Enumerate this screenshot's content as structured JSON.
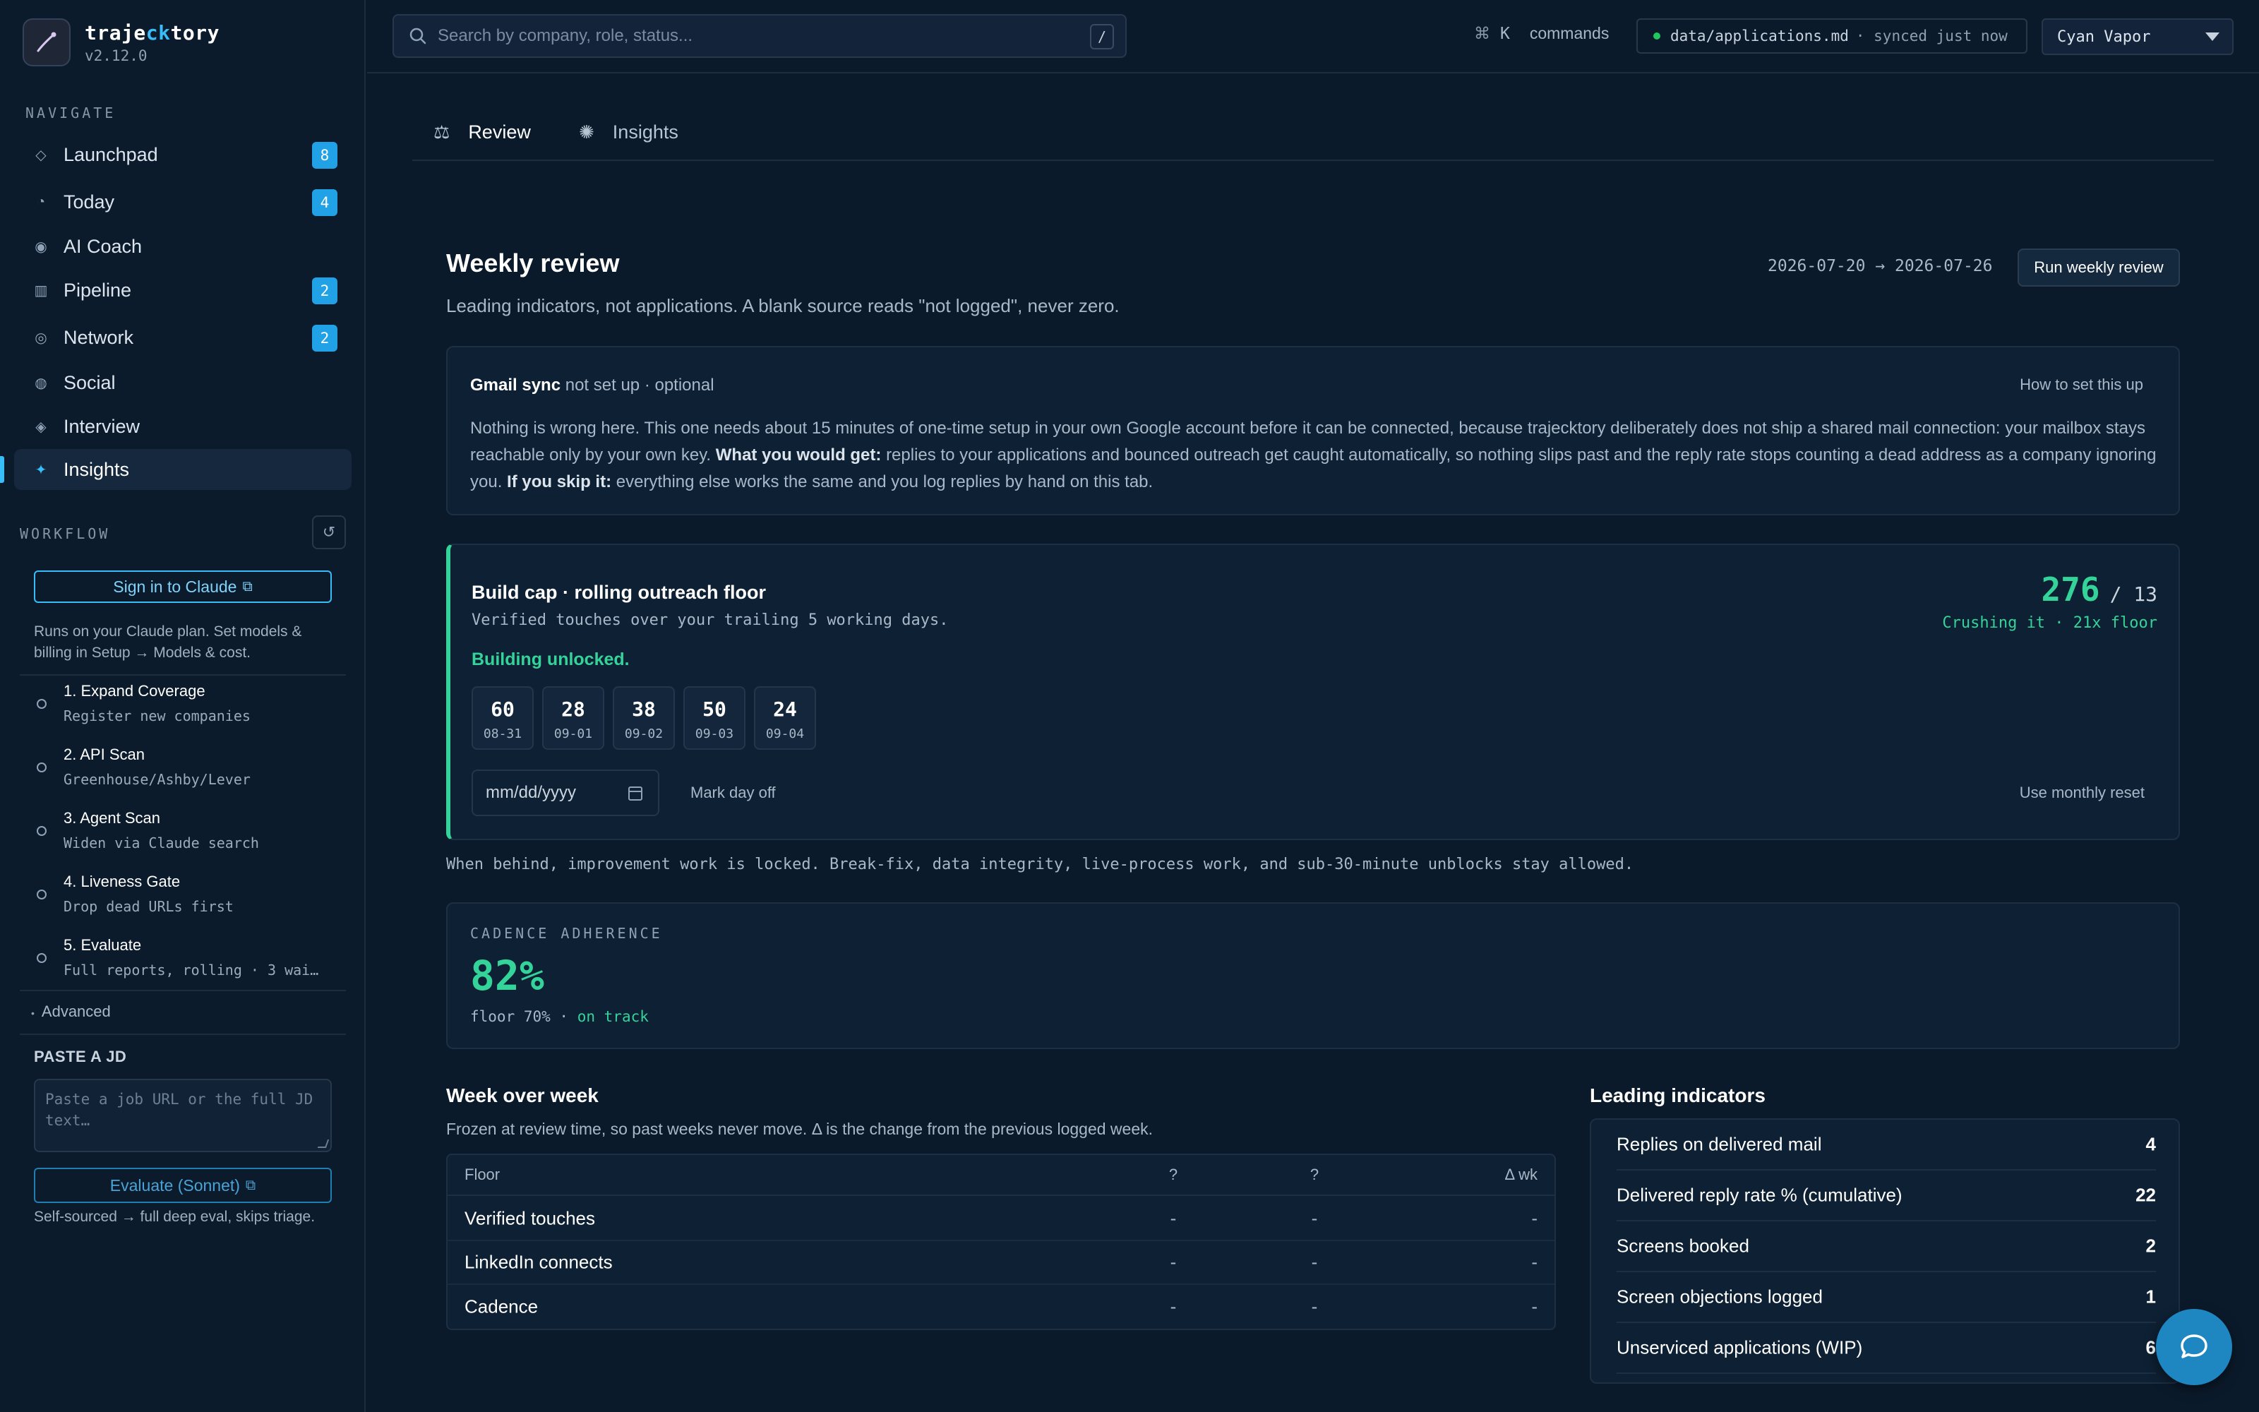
{
  "app": {
    "name_prefix": "traje",
    "name_accent": "ck",
    "name_suffix": "tory",
    "version": "v2.12.0"
  },
  "sidebar": {
    "navigate_label": "NAVIGATE",
    "nav": [
      {
        "label": "Launchpad",
        "badge": "8",
        "icon": "diamond-icon"
      },
      {
        "label": "Today",
        "badge": "4",
        "icon": "clock-icon"
      },
      {
        "label": "AI Coach",
        "badge": null,
        "icon": "target-icon"
      },
      {
        "label": "Pipeline",
        "badge": "2",
        "icon": "kanban-icon"
      },
      {
        "label": "Network",
        "badge": "2",
        "icon": "at-icon"
      },
      {
        "label": "Social",
        "badge": null,
        "icon": "globe-icon"
      },
      {
        "label": "Interview",
        "badge": null,
        "icon": "diamond-filled-icon"
      },
      {
        "label": "Insights",
        "badge": null,
        "icon": "sparkle-icon",
        "active": true
      }
    ],
    "workflow_label": "WORKFLOW",
    "signin_label": "Sign in to Claude",
    "signin_note": "Runs on your Claude plan. Set models & billing in Setup → Models & cost.",
    "steps": [
      {
        "title": "1. Expand Coverage",
        "sub": "Register new companies"
      },
      {
        "title": "2. API Scan",
        "sub": "Greenhouse/Ashby/Lever"
      },
      {
        "title": "3. Agent Scan",
        "sub": "Widen via Claude search"
      },
      {
        "title": "4. Liveness Gate",
        "sub": "Drop dead URLs first"
      },
      {
        "title": "5. Evaluate",
        "sub": "Full reports, rolling · 3 wai…"
      }
    ],
    "advanced_label": "Advanced",
    "paste_label": "PASTE A JD",
    "jd_placeholder": "Paste a job URL or the full JD text…",
    "evaluate_label": "Evaluate (Sonnet)",
    "selfsourced_note": "Self-sourced → full deep eval, skips triage."
  },
  "topbar": {
    "search_placeholder": "Search by company, role, status...",
    "search_shortcut": "/",
    "cmd_glyph": "⌘",
    "cmd_key": "K",
    "commands_label": "commands",
    "sync_file": "data/applications.md",
    "sync_status": "· synced just now",
    "theme": "Cyan Vapor"
  },
  "tabs": [
    {
      "label": "Review",
      "icon": "scale-icon"
    },
    {
      "label": "Insights",
      "icon": "loader-icon"
    }
  ],
  "review": {
    "title": "Weekly review",
    "subtitle": "Leading indicators, not applications. A blank source reads \"not logged\", never zero.",
    "date_range": "2026-07-20 → 2026-07-26",
    "run_label": "Run weekly review",
    "gmail": {
      "name": "Gmail sync",
      "status": "not set up · optional",
      "howto": "How to set this up",
      "body_1": "Nothing is wrong here. This one needs about 15 minutes of one-time setup in your own Google account before it can be connected, because trajecktory deliberately does not ship a shared mail connection: your mailbox stays reachable only by your own key.",
      "get_label": "What you would get:",
      "body_2": "replies to your applications and bounced outreach get caught automatically, so nothing slips past and the reply rate stops counting a dead address as a company ignoring you.",
      "skip_label": "If you skip it:",
      "body_3": "everything else works the same and you log replies by hand on this tab."
    },
    "build": {
      "title": "Build cap · rolling outreach floor",
      "sub": "Verified touches over your trailing 5 working days.",
      "status": "Building unlocked.",
      "count": "276",
      "floor": "/ 13",
      "count_note": "Crushing it · 21x floor",
      "days": [
        {
          "value": "60",
          "date": "08-31"
        },
        {
          "value": "28",
          "date": "09-01"
        },
        {
          "value": "38",
          "date": "09-02"
        },
        {
          "value": "50",
          "date": "09-03"
        },
        {
          "value": "24",
          "date": "09-04"
        }
      ],
      "date_placeholder": "mm/dd/yyyy",
      "mark_off": "Mark day off",
      "monthly_reset": "Use monthly reset"
    },
    "locked_note": "When behind, improvement work is locked. Break-fix, data integrity, live-process work, and sub-30-minute unblocks stay allowed.",
    "cadence": {
      "label": "CADENCE ADHERENCE",
      "value": "82%",
      "floor": "floor 70% ·",
      "status": "on track"
    },
    "wow": {
      "title": "Week over week",
      "sub": "Frozen at review time, so past weeks never move. Δ is the change from the previous logged week.",
      "headers": [
        "Floor",
        "?",
        "?",
        "Δ wk"
      ],
      "rows": [
        [
          "Verified touches",
          "-",
          "-",
          "-"
        ],
        [
          "LinkedIn connects",
          "-",
          "-",
          "-"
        ],
        [
          "Cadence",
          "-",
          "-",
          "-"
        ]
      ]
    },
    "leading": {
      "title": "Leading indicators",
      "rows": [
        {
          "label": "Replies on delivered mail",
          "value": "4"
        },
        {
          "label": "Delivered reply rate % (cumulative)",
          "value": "22"
        },
        {
          "label": "Screens booked",
          "value": "2"
        },
        {
          "label": "Screen objections logged",
          "value": "1"
        },
        {
          "label": "Unserviced applications (WIP)",
          "value": "6"
        }
      ]
    }
  },
  "colors": {
    "accent": "#38bdf8",
    "success": "#34d399",
    "background": "#0b1a2b"
  }
}
